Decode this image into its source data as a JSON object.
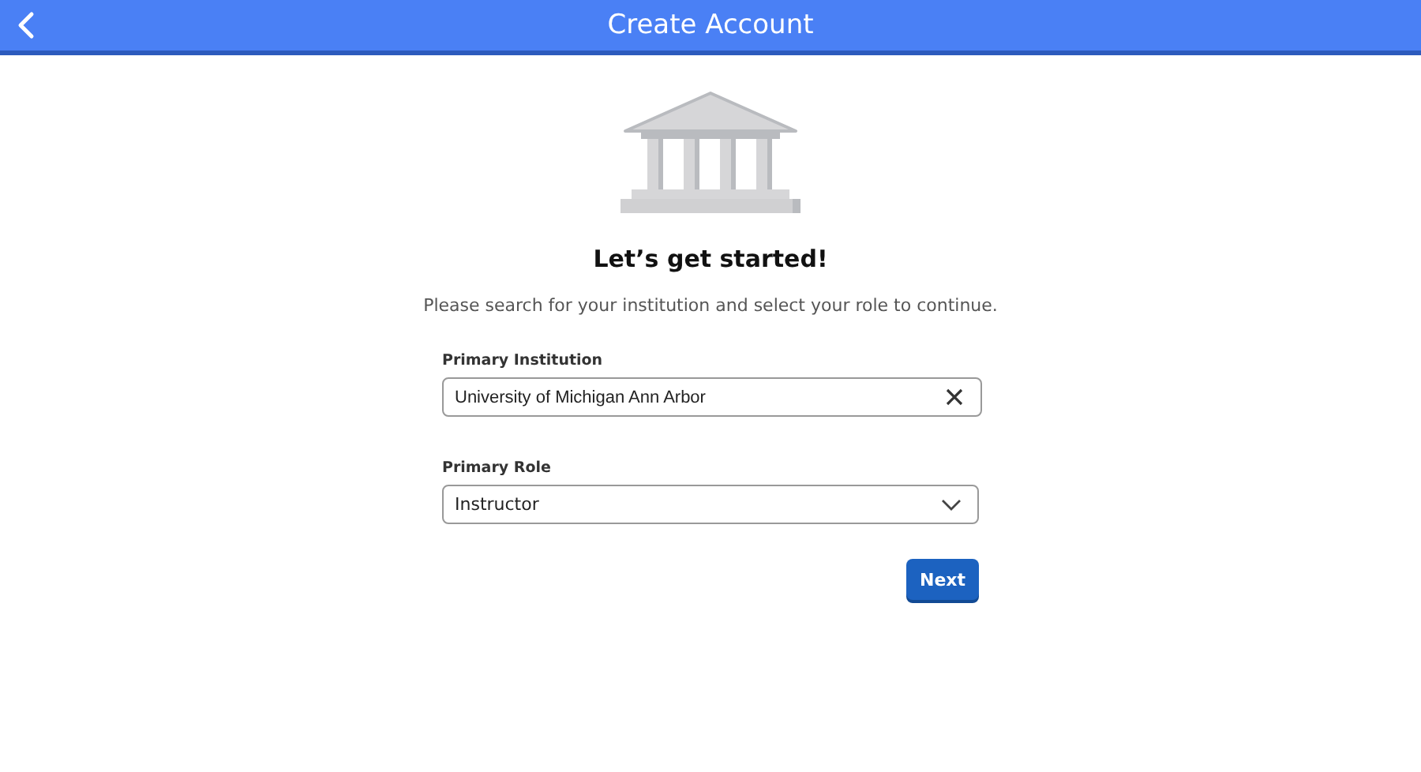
{
  "header": {
    "title": "Create Account"
  },
  "heading": "Let’s get started!",
  "subtitle": "Please search for your institution and select your role to continue.",
  "fields": [
    {
      "kind": "search",
      "label": "Primary Institution",
      "value": "University of Michigan Ann Arbor"
    },
    {
      "kind": "select",
      "label": "Primary Role",
      "value": "Instructor"
    }
  ],
  "buttons": [
    "Next"
  ]
}
